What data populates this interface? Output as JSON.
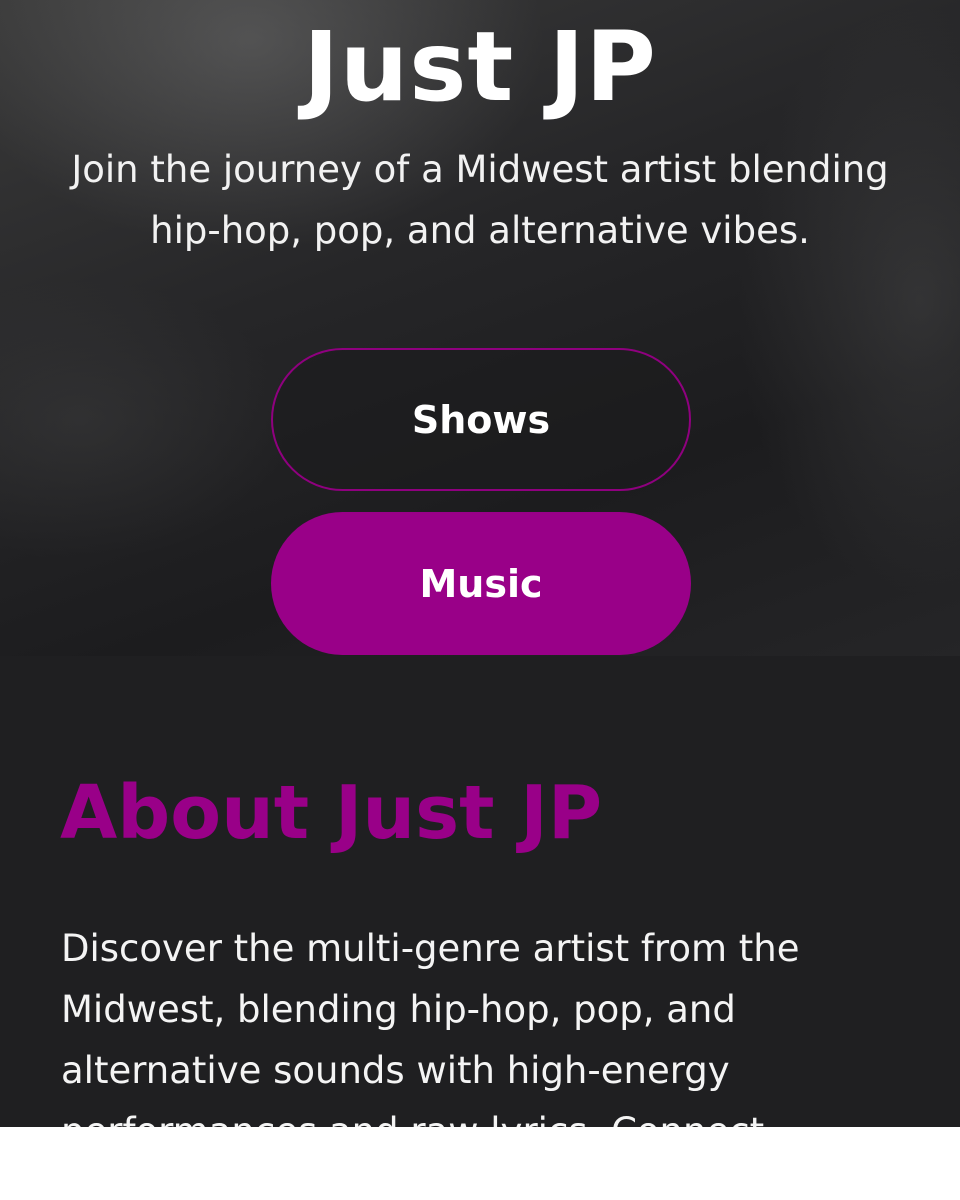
{
  "hero": {
    "title": "Just JP",
    "subtitle": "Join the journey of a Midwest artist blending hip-hop, pop, and alternative vibes.",
    "buttons": {
      "shows": "Shows",
      "music": "Music"
    }
  },
  "about": {
    "title": "About Just JP",
    "text": "Discover the multi-genre artist from the Midwest, blending hip-hop, pop, and alternative sounds with high-energy performances and raw lyrics. Connect"
  },
  "colors": {
    "accent": "#990088",
    "background": "#1e1e20",
    "text": "#ffffff"
  }
}
